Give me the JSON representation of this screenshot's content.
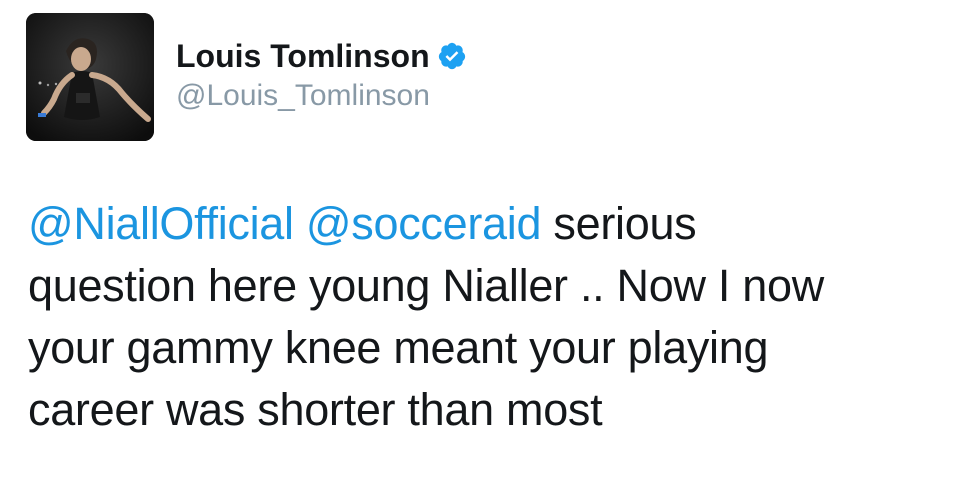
{
  "tweet": {
    "author": {
      "display_name": "Louis Tomlinson",
      "handle": "@Louis_Tomlinson",
      "verified": true,
      "verified_icon": "verified-badge-icon",
      "avatar_icon": "profile-photo"
    },
    "text_lines": [
      {
        "mention1": "@NiallOfficial",
        "mention2": "@socceraid",
        "rest": " serious"
      },
      {
        "text": "question here young Nialler .. Now I now"
      },
      {
        "text": "your gammy knee meant your playing"
      },
      {
        "text": "career was shorter than most"
      }
    ]
  },
  "colors": {
    "mention": "#1b95e0",
    "verified": "#1da1f2",
    "handle": "#8899a6",
    "text": "#14171a"
  }
}
